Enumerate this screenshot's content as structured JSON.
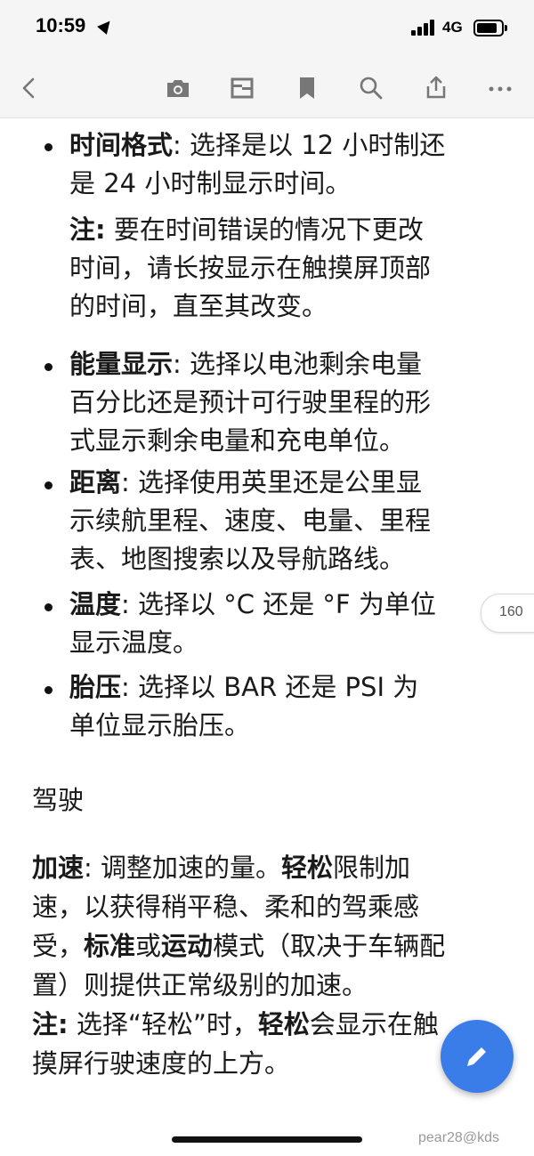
{
  "status": {
    "time": "10:59",
    "network": "4G",
    "battery_level": 0.85
  },
  "toolbar": {
    "icons": [
      "back-icon",
      "camera-icon",
      "reader-mode-icon",
      "bookmark-icon",
      "search-icon",
      "share-icon",
      "more-icon"
    ]
  },
  "content": {
    "bullets": [
      {
        "term": "时间格式",
        "sep": ": ",
        "line1": "选择是以 12 小时制还",
        "line2": "是 24 小时制显示时间。",
        "note_label": "注:",
        "note_l1": "  要在时间错误的情况下更改",
        "note_l2": "时间，请长按显示在触摸屏顶部",
        "note_l3": "的时间，直至其改变。"
      },
      {
        "term": "能量显示",
        "sep": ": ",
        "line1": "选择以电池剩余电量",
        "line2": "百分比还是预计可行驶里程的形",
        "line3": "式显示剩余电量和充电单位。"
      },
      {
        "term": "距离",
        "sep": ": ",
        "line1": "选择使用英里还是公里显",
        "line2": "示续航里程、速度、电量、里程",
        "line3": "表、地图搜索以及导航路线。"
      },
      {
        "term": "温度",
        "sep": ": ",
        "line1": "选择以 °C 还是 °F 为单位",
        "line2": "显示温度。"
      },
      {
        "term": "胎压",
        "sep": ": ",
        "line1": "选择以 BAR 还是 PSI 为",
        "line2": "单位显示胎压。"
      }
    ],
    "section_heading": "驾驶",
    "accel": {
      "term": "加速",
      "sep": ": ",
      "l1a": "调整加速的量。",
      "l1b": "轻松",
      "l1c": "限制加",
      "l2": "速，以获得稍平稳、柔和的驾乘感",
      "l3a": "受，",
      "l3b": "标准",
      "l3c": "或",
      "l3d": "运动",
      "l3e": "模式（取决于车辆配",
      "l4": "置）则提供正常级别的加速。"
    },
    "note2": {
      "label": "注:",
      "l1a": " 选择“轻松”时，",
      "l1b": "轻松",
      "l1c": "会显示在触",
      "l2": "摸屏行驶速度的上方。"
    }
  },
  "page_tab": {
    "number": "160"
  },
  "fab": {
    "icon": "edit-pencil-icon"
  },
  "watermark": "pear28@kds"
}
